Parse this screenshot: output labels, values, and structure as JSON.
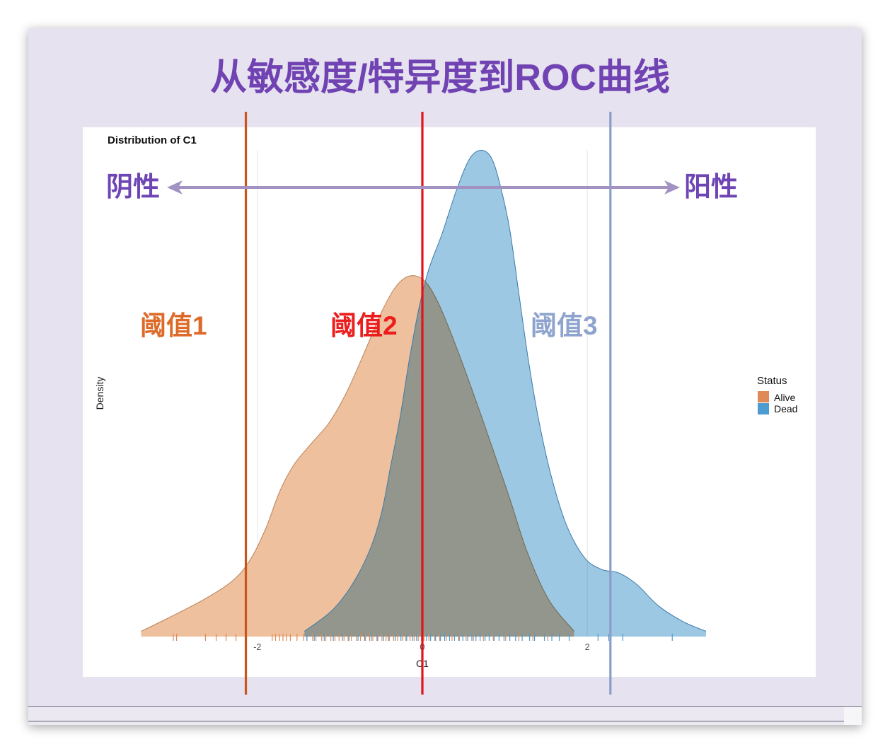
{
  "slide": {
    "title": "从敏感度/特异度到ROC曲线",
    "title_color": "#7042b2",
    "background": "#e6e2f0"
  },
  "direction_arrow": {
    "negative_label": "阴性",
    "positive_label": "阳性",
    "arrow_color": "#a292c3",
    "label_color": "#6e45b4"
  },
  "chart_data": {
    "type": "area",
    "title": "Distribution of C1",
    "xlabel": "C1",
    "ylabel": "Density",
    "xlim": [
      -3.8,
      3.8
    ],
    "ylim": [
      0,
      0.6
    ],
    "x_ticks": [
      -2,
      0,
      2
    ],
    "x_tick_labels": [
      "-2",
      "0",
      "2"
    ],
    "grid": true,
    "legend": {
      "title": "Status",
      "position": "right"
    },
    "series": [
      {
        "name": "Alive",
        "color": "#df8b58",
        "fill": "#eec09d",
        "outline": "#b98259",
        "x": [
          -3.41,
          -3.06,
          -2.63,
          -2.29,
          -2.08,
          -1.9,
          -1.73,
          -1.56,
          -1.35,
          -1.13,
          -0.92,
          -0.7,
          -0.49,
          -0.32,
          -0.15,
          0.03,
          0.2,
          0.41,
          0.63,
          0.84,
          1.06,
          1.27,
          1.53,
          1.84
        ],
        "y": [
          0.006,
          0.022,
          0.043,
          0.064,
          0.088,
          0.122,
          0.164,
          0.194,
          0.218,
          0.242,
          0.276,
          0.322,
          0.368,
          0.396,
          0.408,
          0.402,
          0.376,
          0.328,
          0.272,
          0.216,
          0.156,
          0.096,
          0.042,
          0.006
        ],
        "rug": [
          -3.02,
          -2.98,
          -2.63,
          -2.5,
          -2.38,
          -2.26,
          -1.82,
          -1.78,
          -1.73,
          -1.69,
          -1.65,
          -1.6,
          -1.52,
          -1.44,
          -1.4,
          -1.33,
          -1.29,
          -1.22,
          -1.17,
          -1.11,
          -1.06,
          -1.01,
          -0.95,
          -0.9,
          -0.86,
          -0.8,
          -0.75,
          -0.69,
          -0.64,
          -0.6,
          -0.54,
          -0.49,
          -0.44,
          -0.4,
          -0.35,
          -0.3,
          -0.24,
          -0.2,
          -0.15,
          -0.1,
          -0.05,
          0.02,
          0.08,
          0.15,
          0.21,
          0.29,
          0.36,
          0.45,
          0.53,
          0.62,
          0.74,
          0.86,
          1.01,
          1.17,
          1.34,
          1.52
        ]
      },
      {
        "name": "Dead",
        "color": "#4c9bd1",
        "fill": "#9dc8e3",
        "outline": "#3c7aab",
        "x": [
          -1.43,
          -1.09,
          -0.83,
          -0.62,
          -0.49,
          -0.39,
          -0.27,
          -0.16,
          -0.04,
          0.08,
          0.24,
          0.41,
          0.57,
          0.71,
          0.84,
          0.95,
          1.06,
          1.17,
          1.28,
          1.4,
          1.55,
          1.74,
          1.96,
          2.17,
          2.38,
          2.6,
          2.86,
          3.16,
          3.44
        ],
        "y": [
          0.006,
          0.03,
          0.062,
          0.102,
          0.142,
          0.19,
          0.248,
          0.312,
          0.372,
          0.416,
          0.456,
          0.504,
          0.54,
          0.55,
          0.541,
          0.508,
          0.46,
          0.388,
          0.316,
          0.25,
          0.186,
          0.128,
          0.09,
          0.076,
          0.072,
          0.059,
          0.035,
          0.017,
          0.006
        ],
        "rug": [
          -1.4,
          -1.31,
          -1.19,
          -1.08,
          -0.97,
          -0.89,
          -0.78,
          -0.7,
          -0.62,
          -0.55,
          -0.47,
          -0.41,
          -0.33,
          -0.26,
          -0.19,
          -0.12,
          -0.07,
          -0.01,
          0.05,
          0.1,
          0.16,
          0.22,
          0.27,
          0.33,
          0.39,
          0.44,
          0.49,
          0.55,
          0.6,
          0.65,
          0.7,
          0.76,
          0.81,
          0.87,
          0.93,
          0.99,
          1.06,
          1.13,
          1.21,
          1.3,
          1.36,
          1.48,
          1.57,
          1.66,
          1.78,
          2.13,
          2.26,
          2.43,
          3.03
        ]
      }
    ],
    "thresholds": [
      {
        "label": "阈值1",
        "x": -2.14,
        "color": "#c9541c",
        "label_color": "#dd6a28"
      },
      {
        "label": "阈值2",
        "x": 0,
        "color": "#e3121b",
        "label_color": "#ec1d1d"
      },
      {
        "label": "阈值3",
        "x": 2.28,
        "color": "#8a9ec9",
        "label_color": "#8ea3cd"
      }
    ]
  }
}
